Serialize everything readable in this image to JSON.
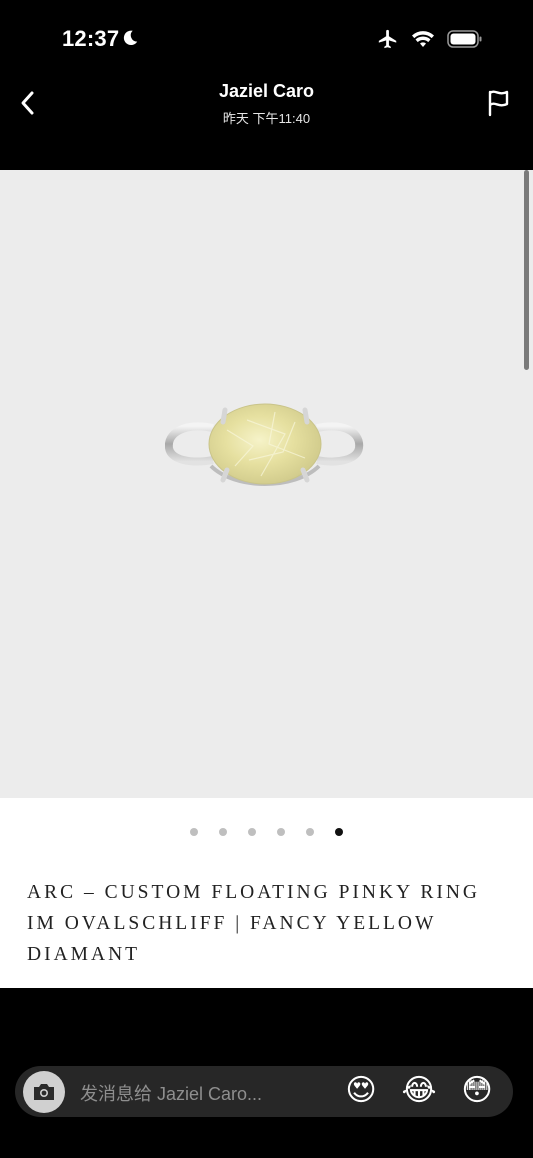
{
  "status_bar": {
    "time": "12:37",
    "icons": [
      "moon-icon",
      "airplane-icon",
      "wifi-icon",
      "battery-icon"
    ]
  },
  "header": {
    "title": "Jaziel Caro",
    "subtitle": "昨天 下午11:40",
    "left_icon": "chevron-left-icon",
    "right_icon": "flag-icon"
  },
  "product": {
    "image_dots_total": 6,
    "image_dot_active": 6,
    "title": "ARC – CUSTOM FLOATING PINKY RING IM OVALSCHLIFF | FANCY YELLOW DIAMANT"
  },
  "composer": {
    "placeholder": "发消息给 Jaziel Caro...",
    "camera_icon": "camera-icon",
    "quick_reactions": [
      "😍",
      "😂",
      "😳"
    ]
  },
  "colors": {
    "background": "#000000",
    "card": "#ffffff",
    "image_bg": "#ececec",
    "composer_bg": "#272727"
  }
}
